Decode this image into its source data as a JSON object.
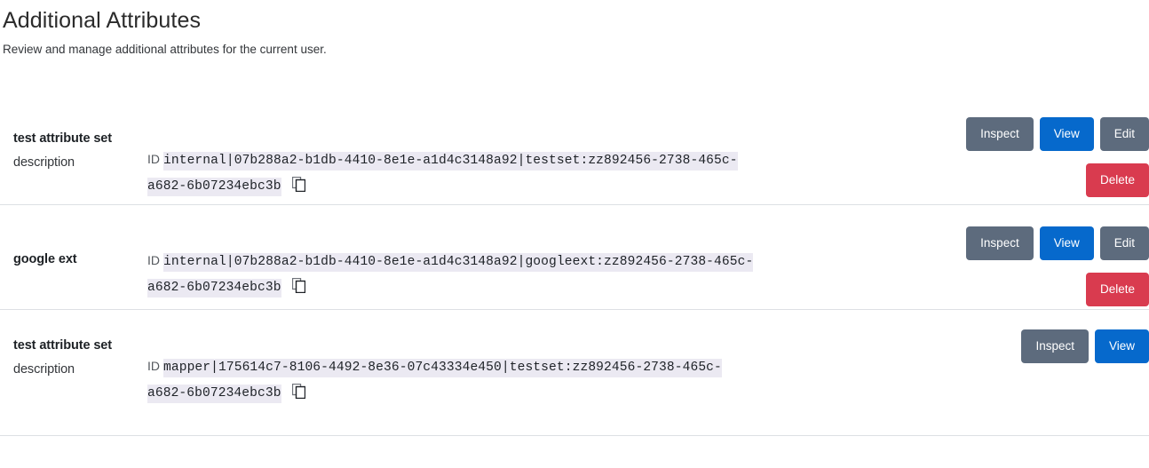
{
  "header": {
    "title": "Additional Attributes",
    "subtitle": "Review and manage additional attributes for the current user."
  },
  "colors": {
    "secondary_button": "#5d6b7d",
    "primary_button": "#0669cc",
    "danger_button": "#d93b4f",
    "code_background": "#ebe9f2",
    "divider": "#dde0e4"
  },
  "id_tag_label": "ID",
  "copy_icon_name": "copy-icon",
  "rows": [
    {
      "name": "test attribute set",
      "description": "description",
      "id_line_1": "internal|07b288a2-b1db-4410-8e1e-a1d4c3148a92|testset:zz892456-2738-465c-",
      "id_line_2": "a682-6b07234ebc3b",
      "id_full": "internal|07b288a2-b1db-4410-8e1e-a1d4c3148a92|testset:zz892456-2738-465c-a682-6b07234ebc3b",
      "buttons": [
        {
          "label": "Inspect",
          "style": "secondary"
        },
        {
          "label": "View",
          "style": "primary"
        },
        {
          "label": "Edit",
          "style": "secondary"
        },
        {
          "label": "Delete",
          "style": "danger"
        }
      ]
    },
    {
      "name": "google ext",
      "description": "",
      "id_line_1": "internal|07b288a2-b1db-4410-8e1e-a1d4c3148a92|googleext:zz892456-2738-465c-",
      "id_line_2": "a682-6b07234ebc3b",
      "id_full": "internal|07b288a2-b1db-4410-8e1e-a1d4c3148a92|googleext:zz892456-2738-465c-a682-6b07234ebc3b",
      "buttons": [
        {
          "label": "Inspect",
          "style": "secondary"
        },
        {
          "label": "View",
          "style": "primary"
        },
        {
          "label": "Edit",
          "style": "secondary"
        },
        {
          "label": "Delete",
          "style": "danger"
        }
      ]
    },
    {
      "name": "test attribute set",
      "description": "description",
      "id_line_1": "mapper|175614c7-8106-4492-8e36-07c43334e450|testset:zz892456-2738-465c-",
      "id_line_2": "a682-6b07234ebc3b",
      "id_full": "mapper|175614c7-8106-4492-8e36-07c43334e450|testset:zz892456-2738-465c-a682-6b07234ebc3b",
      "buttons": [
        {
          "label": "Inspect",
          "style": "secondary"
        },
        {
          "label": "View",
          "style": "primary"
        }
      ]
    }
  ]
}
